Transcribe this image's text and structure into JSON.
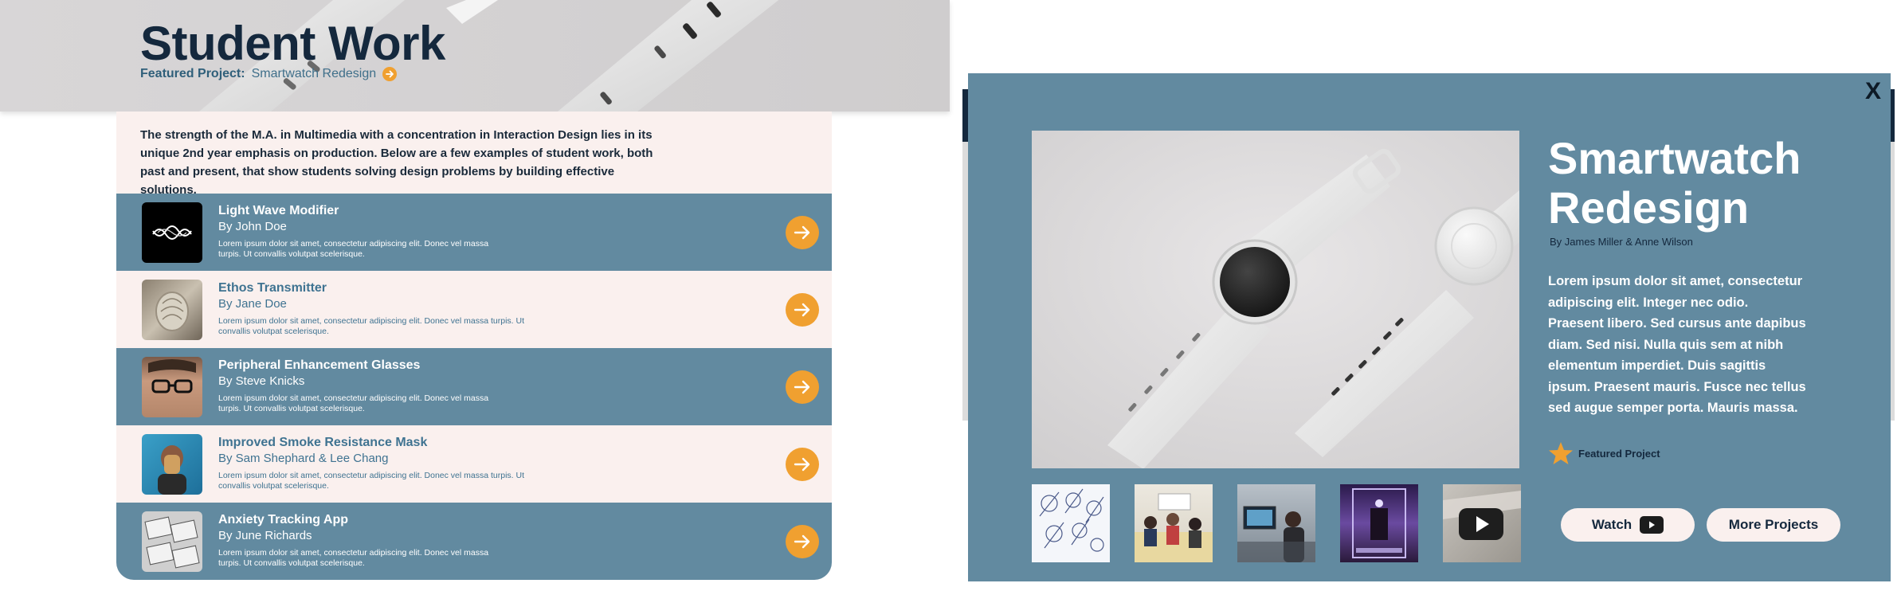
{
  "left": {
    "title": "Student Work",
    "featured_label": "Featured Project:",
    "featured_name": "Smartwatch Redesign",
    "intro": "The strength of the M.A. in Multimedia with a concentration in Interaction Design lies in its unique 2nd year emphasis on production.  Below are a few examples of student work, both past and present, that show students solving design problems by building effective solutions.",
    "projects": [
      {
        "title": "Light Wave Modifier",
        "author": "By John Doe",
        "description": "Lorem ipsum dolor sit amet, consectetur adipiscing elit. Donec vel massa turpis. Ut convallis volutpat scelerisque."
      },
      {
        "title": "Ethos Transmitter",
        "author": "By Jane Doe",
        "description": "Lorem ipsum dolor sit amet, consectetur adipiscing elit. Donec vel massa turpis. Ut convallis volutpat scelerisque."
      },
      {
        "title": "Peripheral Enhancement Glasses",
        "author": "By Steve Knicks",
        "description": "Lorem ipsum dolor sit amet, consectetur adipiscing elit. Donec vel massa turpis. Ut convallis volutpat scelerisque."
      },
      {
        "title": "Improved Smoke Resistance Mask",
        "author": "By Sam Shephard & Lee Chang",
        "description": "Lorem ipsum dolor sit amet, consectetur adipiscing elit. Donec vel massa turpis. Ut convallis volutpat scelerisque."
      },
      {
        "title": "Anxiety Tracking App",
        "author": "By June Richards",
        "description": "Lorem ipsum dolor sit amet, consectetur adipiscing elit. Donec vel massa turpis. Ut convallis volutpat scelerisque."
      }
    ]
  },
  "modal": {
    "close_label": "X",
    "title": "Smartwatch Redesign",
    "authors": "By James Miller & Anne Wilson",
    "body": "Lorem ipsum dolor sit amet, consectetur adipiscing elit. Integer nec odio. Praesent libero. Sed cursus ante dapibus diam. Sed nisi. Nulla quis sem at nibh elementum imperdiet. Duis sagittis ipsum. Praesent mauris. Fusce nec tellus sed augue semper porta. Mauris massa.",
    "badge_label": "Featured Project",
    "watch_label": "Watch",
    "more_label": "More Projects",
    "gallery_icons": [
      "watch-sketches",
      "team-meeting",
      "designer-at-computer",
      "lab-equipment",
      "video-thumbnail"
    ]
  },
  "colors": {
    "accent": "#f0a030",
    "slate": "#628aa0",
    "navy": "#14283d",
    "cream": "#faf0ee"
  }
}
